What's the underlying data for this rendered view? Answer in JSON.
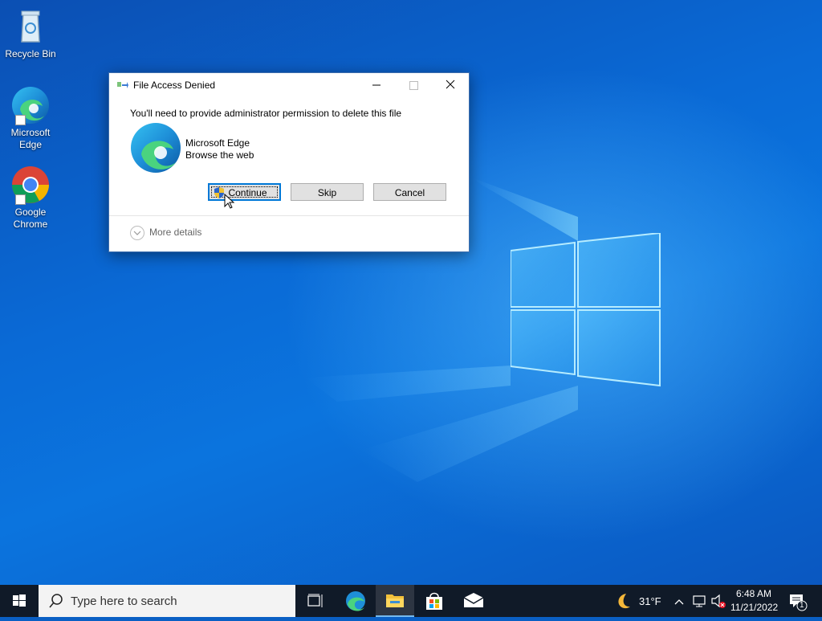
{
  "desktop": {
    "icons": [
      {
        "label": "Recycle Bin"
      },
      {
        "label": "Microsoft Edge"
      },
      {
        "label": "Google Chrome"
      }
    ]
  },
  "dialog": {
    "title": "File Access Denied",
    "message": "You'll need to provide administrator permission to delete this file",
    "app_name": "Microsoft Edge",
    "app_description": "Browse the web",
    "buttons": {
      "continue": "Continue",
      "skip": "Skip",
      "cancel": "Cancel"
    },
    "more_details": "More details"
  },
  "taskbar": {
    "search_placeholder": "Type here to search",
    "weather": "31°F",
    "time": "6:48 AM",
    "date": "11/21/2022",
    "notification_count": "1"
  },
  "colors": {
    "accent": "#0078d7",
    "taskbar": "#101a28",
    "desktop": "#0a6ad6"
  }
}
